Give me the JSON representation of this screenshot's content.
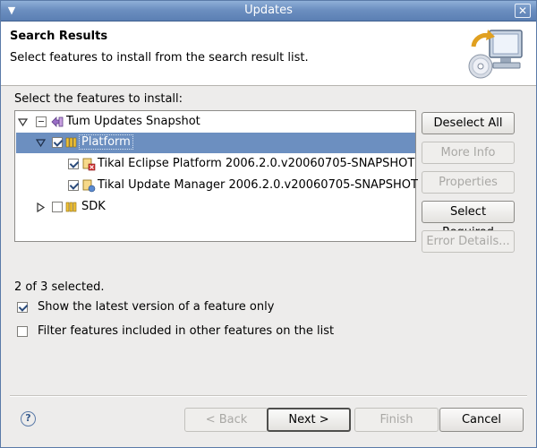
{
  "window": {
    "title": "Updates"
  },
  "header": {
    "title": "Search Results",
    "description": "Select features to install from the search result list."
  },
  "tree_section": {
    "label": "Select the features to install:"
  },
  "tree": {
    "items": [
      {
        "label": "Tum Updates Snapshot",
        "expanded": true,
        "check": "mixed",
        "icon": "site-icon"
      },
      {
        "label": "Platform",
        "expanded": true,
        "check": "checked",
        "icon": "category-icon",
        "selected": true
      },
      {
        "label": "Tikal Eclipse Platform 2006.2.0.v20060705-SNAPSHOT",
        "check": "checked",
        "icon": "feature-icon"
      },
      {
        "label": "Tikal Update Manager 2006.2.0.v20060705-SNAPSHOT",
        "check": "checked",
        "icon": "feature-icon"
      },
      {
        "label": "SDK",
        "expanded": false,
        "check": "unchecked",
        "icon": "category-icon"
      }
    ]
  },
  "side_buttons": {
    "deselect_all": "Deselect All",
    "more_info": "More Info",
    "properties": "Properties",
    "select_required": "Select Required",
    "error_details": "Error Details..."
  },
  "selection_count": "2 of 3 selected.",
  "options": {
    "latest_version": {
      "label": "Show the latest version of a feature only",
      "checked": true
    },
    "filter_included": {
      "label": "Filter features included in other features on the list",
      "checked": false
    }
  },
  "nav": {
    "back": "< Back",
    "next": "Next >",
    "finish": "Finish",
    "cancel": "Cancel"
  },
  "colors": {
    "titlebar": "#6c8fc0",
    "selection": "#6c8fc0",
    "dialog_bg": "#edeceb"
  }
}
